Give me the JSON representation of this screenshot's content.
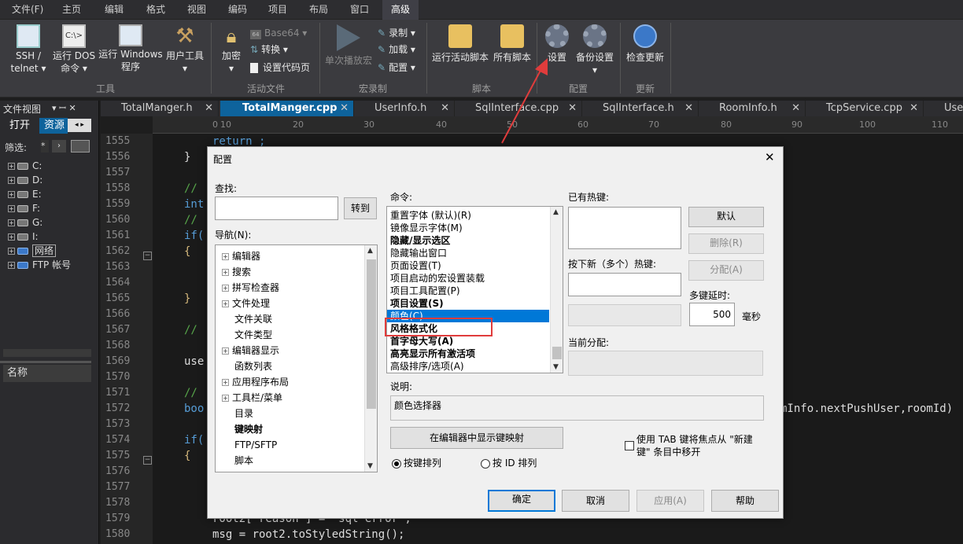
{
  "menubar": {
    "items": [
      "文件(F)",
      "主页",
      "编辑",
      "格式",
      "视图",
      "编码",
      "项目",
      "布局",
      "窗口",
      "高级"
    ],
    "active": "高级"
  },
  "ribbon": {
    "buttons": {
      "ssh": "SSH /\ntelnet ▾",
      "dos": "运行 DOS\n命令 ▾",
      "windows": "运行 Windows\n程序",
      "usertools": "用户工具\n▾",
      "encrypt": "加密\n▾",
      "single_play": "单次播放宏",
      "run_script": "运行活动脚本",
      "all_scripts": "所有脚本",
      "settings": "设置",
      "backup": "备份设置\n▾",
      "update": "检查更新"
    },
    "small": {
      "base64": "Base64 ▾",
      "convert": "转换 ▾",
      "codepage": "设置代码页",
      "record": "录制 ▾",
      "load": "加载 ▾",
      "config": "配置 ▾"
    },
    "groups": [
      "工具",
      "活动文件",
      "宏录制",
      "脚本",
      "配置",
      "更新"
    ]
  },
  "leftpanel": {
    "title": "文件视图",
    "pin": "▾ ꟷ ✕",
    "tabs": [
      "打开",
      "资源"
    ],
    "filter_label": "筛选:",
    "filter_value": "*",
    "tree": [
      "C:",
      "D:",
      "E:",
      "F:",
      "G:",
      "I:",
      "网络",
      "FTP 帐号"
    ],
    "name_header": "名称"
  },
  "tabs": [
    "TotalManger.h",
    "TotalManger.cpp",
    "UserInfo.h",
    "SqlInterface.cpp",
    "SqlInterface.h",
    "RoomInfo.h",
    "TcpService.cpp",
    "Use"
  ],
  "active_tab": "TotalManger.cpp",
  "ruler": [
    "0",
    "10",
    "20",
    "30",
    "40",
    "50",
    "60",
    "70",
    "80",
    "90",
    "100",
    "110"
  ],
  "line_numbers": [
    "1555",
    "1556",
    "1557",
    "1558",
    "1559",
    "1560",
    "1561",
    "1562",
    "1563",
    "1564",
    "1565",
    "1566",
    "1567",
    "1568",
    "1569",
    "1570",
    "1571",
    "1572",
    "1573",
    "1574",
    "1575",
    "1576",
    "1577",
    "1578",
    "1579",
    "1580"
  ],
  "code": {
    "l1555": "return ;",
    "l1556": "}",
    "l1558": "//",
    "l1559": "int",
    "l1560": "//",
    "l1561": "if(",
    "l1562": "{",
    "l1565": "}",
    "l1567": "//",
    "l1569": "use",
    "l1571": "//",
    "l1572": "boo",
    "l1572_tail": "mInfo.nextPushUser,roomId)",
    "l1574": "if(",
    "l1575": "{",
    "l1579": "root2[\"reason\"] = \"sql error\";",
    "l1580": "msg = root2.toStyledString();"
  },
  "dialog": {
    "title": "配置",
    "close": "✕",
    "find_label": "查找:",
    "find_value": "",
    "goto_button": "转到",
    "nav_label": "导航(N):",
    "nav_items": [
      {
        "label": "编辑器",
        "plus": true,
        "bold": false
      },
      {
        "label": "搜索",
        "plus": true,
        "bold": false
      },
      {
        "label": "拼写检查器",
        "plus": true,
        "bold": false
      },
      {
        "label": "文件处理",
        "plus": true,
        "bold": false
      },
      {
        "label": "文件关联",
        "plus": false,
        "bold": false
      },
      {
        "label": "文件类型",
        "plus": false,
        "bold": false
      },
      {
        "label": "编辑器显示",
        "plus": true,
        "bold": false
      },
      {
        "label": "函数列表",
        "plus": false,
        "bold": false
      },
      {
        "label": "应用程序布局",
        "plus": true,
        "bold": false
      },
      {
        "label": "工具栏/菜单",
        "plus": true,
        "bold": false
      },
      {
        "label": "目录",
        "plus": false,
        "bold": false
      },
      {
        "label": "键映射",
        "plus": false,
        "bold": true
      },
      {
        "label": "FTP/SFTP",
        "plus": false,
        "bold": false
      },
      {
        "label": "脚本",
        "plus": false,
        "bold": false
      }
    ],
    "cmd_label": "命令:",
    "commands": [
      {
        "label": "重置字体 (默认)(R)",
        "bold": false
      },
      {
        "label": "镜像显示字体(M)",
        "bold": false
      },
      {
        "label": "隐藏/显示选区",
        "bold": true
      },
      {
        "label": "隐藏输出窗口",
        "bold": false
      },
      {
        "label": "页面设置(T)",
        "bold": false
      },
      {
        "label": "项目启动的宏设置装载",
        "bold": false
      },
      {
        "label": "项目工具配置(P)",
        "bold": false
      },
      {
        "label": "项目设置(S)",
        "bold": true
      },
      {
        "label": "颜色(C)",
        "bold": false,
        "selected": true
      },
      {
        "label": "风格格式化",
        "bold": true
      },
      {
        "label": "首字母大写(A)",
        "bold": true
      },
      {
        "label": "高亮显示所有激活项",
        "bold": true
      },
      {
        "label": "高级排序/选项(A)",
        "bold": false
      }
    ],
    "hotkeys_label": "已有热键:",
    "default_button": "默认",
    "delete_button": "删除(R)",
    "press_label": "按下新（多个）热键:",
    "assign_button": "分配(A)",
    "multikey_label": "多键延时:",
    "multikey_value": "500",
    "ms_label": "毫秒",
    "current_label": "当前分配:",
    "desc_label": "说明:",
    "desc_value": "颜色选择器",
    "show_mapping_button": "在编辑器中显示键映射",
    "radio_key": "按键排列",
    "radio_id": "按 ID 排列",
    "tab_check_label": "使用 TAB 键将焦点从 \"新建键\" 条目中移开",
    "ok_button": "确定",
    "cancel_button": "取消",
    "apply_button": "应用(A)",
    "help_button": "帮助"
  },
  "colors": {
    "accent": "#0078d7",
    "highlight_box": "#e03c3c",
    "arrow": "#e03c3c"
  }
}
